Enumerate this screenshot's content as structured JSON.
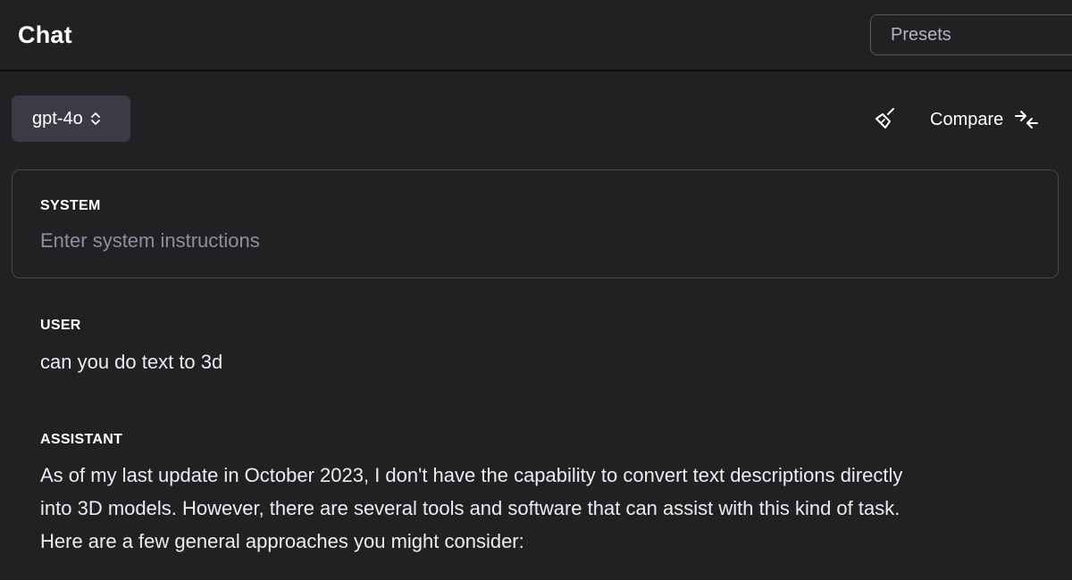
{
  "header": {
    "title": "Chat",
    "presets_placeholder": "Presets"
  },
  "toolbar": {
    "model": "gpt-4o",
    "compare_label": "Compare"
  },
  "system": {
    "label": "SYSTEM",
    "placeholder": "Enter system instructions"
  },
  "messages": [
    {
      "role": "USER",
      "lines": [
        "can you do text to 3d"
      ]
    },
    {
      "role": "ASSISTANT",
      "lines": [
        "As of my last update in October 2023, I don't have the capability to convert text descriptions directly",
        "into 3D models. However, there are several tools and software that can assist with this kind of task.",
        "Here are a few general approaches you might consider:"
      ]
    }
  ],
  "icons": {
    "model_chevron": "chevron-up-down-icon",
    "clear": "broom-icon",
    "compare": "compare-arrows-icon"
  },
  "colors": {
    "background": "#202123",
    "model_select_bg": "#3a3b44",
    "placeholder_text": "#8e8ea0"
  }
}
